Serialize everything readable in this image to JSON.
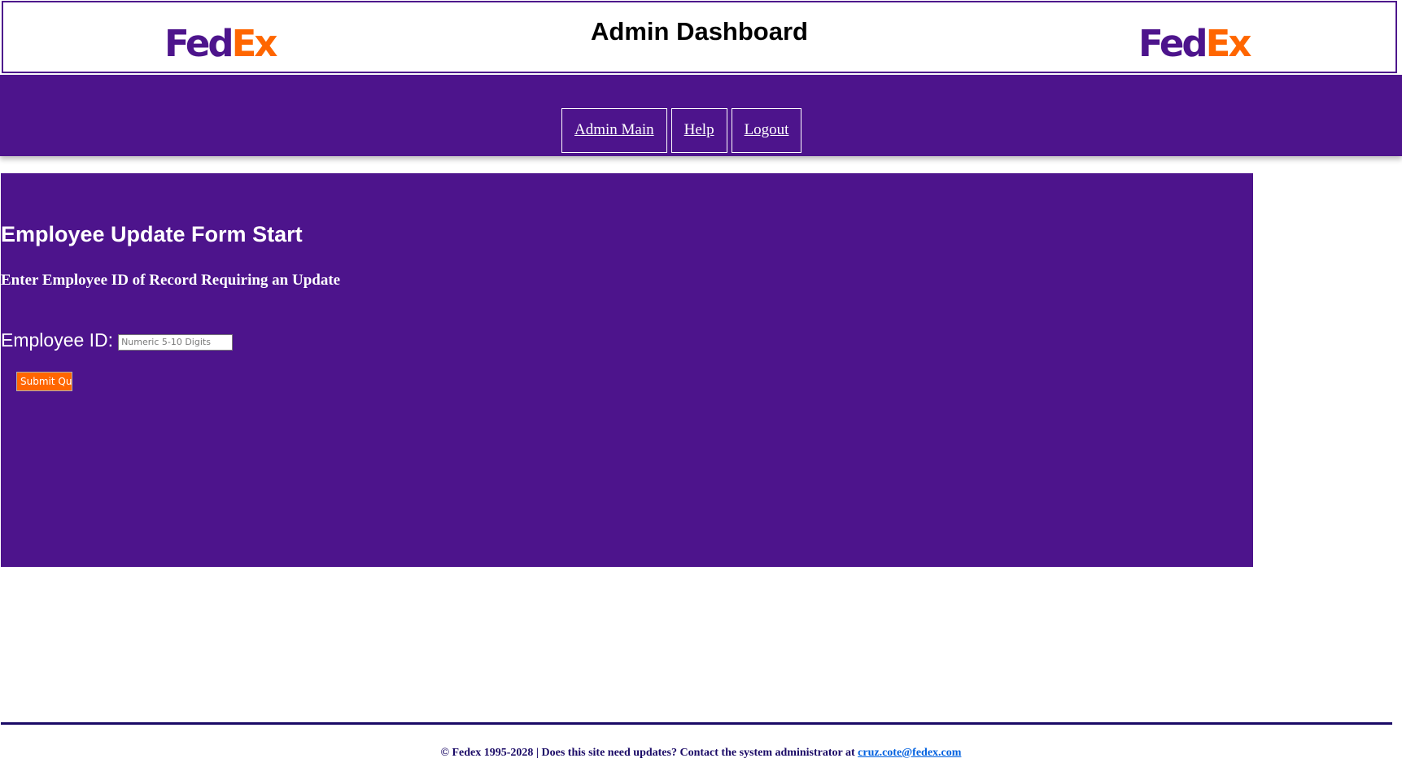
{
  "header": {
    "title": "Admin Dashboard",
    "logo_left": {
      "part1": "Fed",
      "part2": "Ex"
    },
    "logo_right": {
      "part1": "Fed",
      "part2": "Ex"
    }
  },
  "nav": {
    "items": [
      {
        "label": "Admin Main"
      },
      {
        "label": "Help"
      },
      {
        "label": "Logout"
      }
    ]
  },
  "form": {
    "title": "Employee Update Form Start",
    "subtitle": "Enter Employee ID of Record Requiring an Update",
    "employee_id_label": "Employee ID:",
    "employee_id_placeholder": "Numeric 5-10 Digits",
    "employee_id_value": "",
    "submit_label": "Submit Query"
  },
  "footer": {
    "text": "© Fedex 1995-2028 | Does this site need updates? Contact the system administrator at",
    "email": "cruz.cote@fedex.com"
  },
  "colors": {
    "brand_purple": "#4d148c",
    "brand_orange": "#ff6600",
    "footer_navy": "#1a0a66",
    "link_blue": "#0060df"
  }
}
